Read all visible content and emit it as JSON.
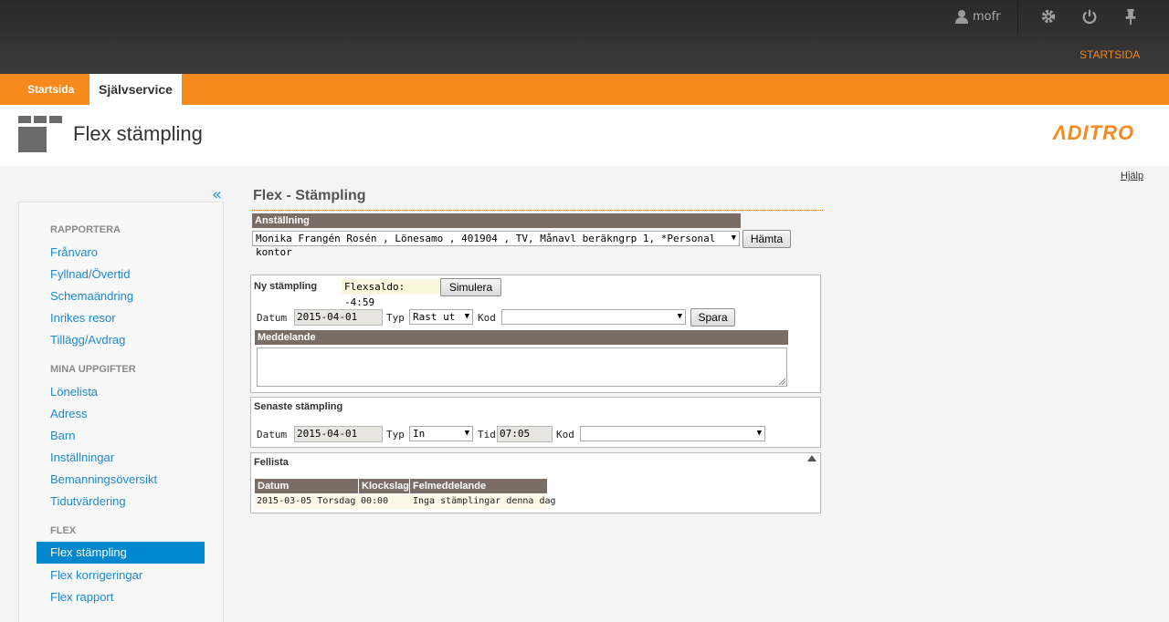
{
  "header": {
    "username": "mofr",
    "startsida_link": "STARTSIDA",
    "icons": [
      "user-icon",
      "gear-icon",
      "power-icon",
      "pin-icon"
    ]
  },
  "tabs": [
    {
      "label": "Startsida",
      "active": false
    },
    {
      "label": "Självservice",
      "active": true
    }
  ],
  "page": {
    "title": "Flex stämpling",
    "logo": "ΛDITRO",
    "help": "Hjälp"
  },
  "sidebar": {
    "collapse": "«",
    "sections": [
      {
        "title": "RAPPORTERA",
        "items": [
          "Frånvaro",
          "Fyllnad/Övertid",
          "Schemaändring",
          "Inrikes resor",
          "Tillägg/Avdrag"
        ]
      },
      {
        "title": "MINA UPPGIFTER",
        "items": [
          "Lönelista",
          "Adress",
          "Barn",
          "Inställningar",
          "Bemanningsöversikt",
          "Tidutvärdering"
        ]
      },
      {
        "title": "FLEX",
        "items": [
          "Flex stämpling",
          "Flex korrigeringar",
          "Flex rapport"
        ]
      }
    ],
    "active_item": "Flex stämpling"
  },
  "main": {
    "heading": "Flex - Stämpling",
    "anstallning": {
      "label": "Anställning",
      "value": "Monika Frangén Rosén , Lönesamo , 401904 , TV, Månavl beräkngrp 1, *Personal kontor",
      "button": "Hämta"
    },
    "ny": {
      "title": "Ny stämpling",
      "flexsaldo": "Flexsaldo: -4:59",
      "simulera": "Simulera",
      "datum_label": "Datum",
      "datum": "2015-04-01",
      "typ_label": "Typ",
      "typ": "Rast ut",
      "kod_label": "Kod",
      "kod": "",
      "spara": "Spara",
      "meddelande_label": "Meddelande",
      "meddelande": ""
    },
    "senaste": {
      "title": "Senaste stämpling",
      "datum_label": "Datum",
      "datum": "2015-04-01",
      "typ_label": "Typ",
      "typ": "In",
      "tid_label": "Tid",
      "tid": "07:05",
      "kod_label": "Kod",
      "kod": ""
    },
    "fellista": {
      "title": "Fellista",
      "columns": [
        "Datum",
        "Klockslag",
        "Felmeddelande"
      ],
      "rows": [
        [
          "2015-03-05 Torsdag",
          "00:00",
          "Inga stämplingar denna dag"
        ]
      ]
    }
  }
}
